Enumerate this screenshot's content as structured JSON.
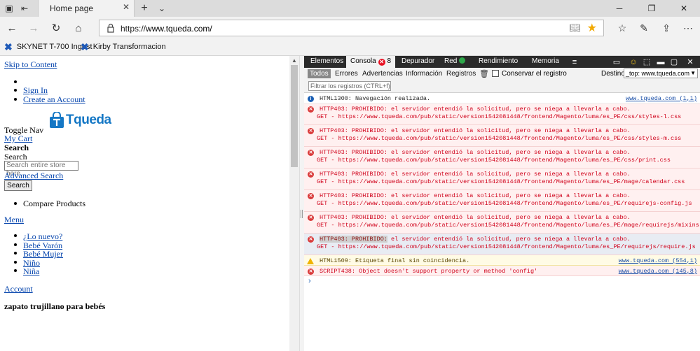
{
  "browser": {
    "tab_title": "Home page",
    "new_tab_symbol": "+",
    "url_scheme": "https://",
    "url_host": "www.tqueda.com/",
    "favorites": [
      {
        "label": "SKYNET T-700 Ingest",
        "icon": "bookmark-icon"
      },
      {
        "label": "Kirby Transformacion",
        "icon": "bookmark-icon"
      }
    ],
    "star_color": "#f2a900"
  },
  "page": {
    "skip_link": "Skip to Content",
    "header_links": [
      "Sign In",
      "Create an Account"
    ],
    "logo_text": "Tqueda",
    "toggle_nav": "Toggle Nav",
    "my_cart": "My Cart",
    "search_heading": "Search",
    "search_label": "Search",
    "search_placeholder": "Search entire store here...",
    "advanced_search": "Advanced Search",
    "search_button": "Search",
    "compare_products": "Compare Products",
    "menu": "Menu",
    "menu_items": [
      "¿Lo nuevo?",
      "Bebé Varón",
      "Bebé Mujer",
      "Niño",
      "Niña"
    ],
    "account": "Account",
    "product_heading": "zapato trujillano para bebés"
  },
  "devtools": {
    "tabs": [
      "Elementos",
      "Consola",
      "Depurador",
      "Red",
      "Rendimiento",
      "Memoria"
    ],
    "error_count": "8",
    "filters": [
      "Todos",
      "Errores",
      "Advertencias",
      "Información",
      "Registros"
    ],
    "keep_log_label": "Conservar el registro",
    "target_label": "Destino",
    "target_value": "_top: www.tqueda.com",
    "filter_placeholder": "Filtrar los registros (CTRL+f)",
    "messages": [
      {
        "type": "info",
        "text": "HTML1300: Navegación realizada.",
        "source": "www.tqueda.com (1,1)"
      },
      {
        "type": "error",
        "code": "HTTP403: PROHIBIDO:",
        "text": " el servidor entendió la solicitud, pero se niega a llevarla a cabo.",
        "get": "GET - https://www.tqueda.com/pub/static/version1542081448/frontend/Magento/luma/es_PE/css/styles-l.css"
      },
      {
        "type": "error",
        "code": "HTTP403: PROHIBIDO:",
        "text": " el servidor entendió la solicitud, pero se niega a llevarla a cabo.",
        "get": "GET - https://www.tqueda.com/pub/static/version1542081448/frontend/Magento/luma/es_PE/css/styles-m.css"
      },
      {
        "type": "error",
        "code": "HTTP403: PROHIBIDO:",
        "text": " el servidor entendió la solicitud, pero se niega a llevarla a cabo.",
        "get": "GET - https://www.tqueda.com/pub/static/version1542081448/frontend/Magento/luma/es_PE/css/print.css"
      },
      {
        "type": "error",
        "code": "HTTP403: PROHIBIDO:",
        "text": " el servidor entendió la solicitud, pero se niega a llevarla a cabo.",
        "get": "GET - https://www.tqueda.com/pub/static/version1542081448/frontend/Magento/luma/es_PE/mage/calendar.css"
      },
      {
        "type": "error",
        "code": "HTTP403: PROHIBIDO:",
        "text": " el servidor entendió la solicitud, pero se niega a llevarla a cabo.",
        "get": "GET - https://www.tqueda.com/pub/static/version1542081448/frontend/Magento/luma/es_PE/requirejs-config.js"
      },
      {
        "type": "error",
        "code": "HTTP403: PROHIBIDO:",
        "text": " el servidor entendió la solicitud, pero se niega a llevarla a cabo.",
        "get": "GET - https://www.tqueda.com/pub/static/version1542081448/frontend/Magento/luma/es_PE/mage/requirejs/mixins.js"
      },
      {
        "type": "error",
        "code": "HTTP403: PROHIBIDO:",
        "text": " el servidor entendió la solicitud, pero se niega a llevarla a cabo.",
        "get": "GET - https://www.tqueda.com/pub/static/version1542081448/frontend/Magento/luma/es_PE/requirejs/require.js"
      },
      {
        "type": "warning",
        "text": "HTML1509: Etiqueta final sin coincidencia.",
        "source": "www.tqueda.com (554,1)"
      },
      {
        "type": "error",
        "text": "SCRIPT438: Object doesn't support property or method 'config'",
        "source": "www.tqueda.com (145,8)"
      }
    ]
  }
}
